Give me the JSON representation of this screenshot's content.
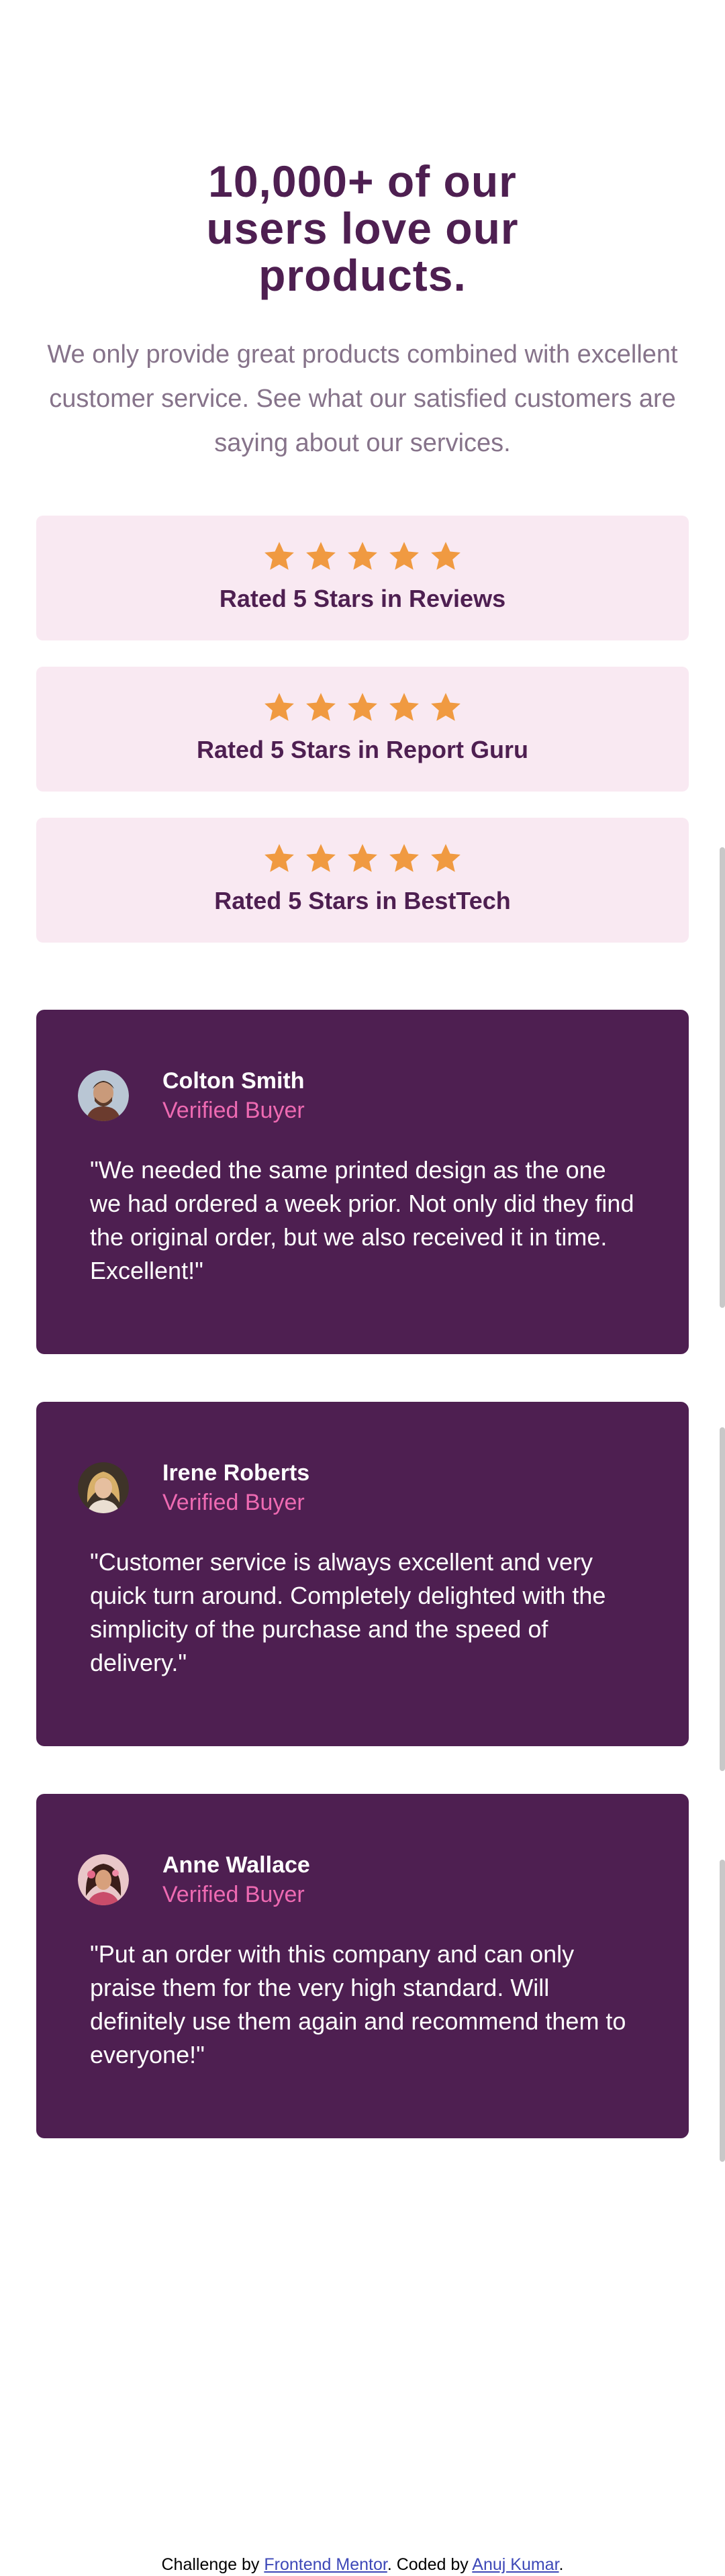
{
  "hero": {
    "title": "10,000+ of our users love our products.",
    "description": "We only provide great products combined with excellent customer service. See what our satisfied customers are saying about our services."
  },
  "ratings": [
    {
      "stars": 5,
      "label": "Rated 5 Stars in Reviews"
    },
    {
      "stars": 5,
      "label": "Rated 5 Stars in Report Guru"
    },
    {
      "stars": 5,
      "label": "Rated 5 Stars in BestTech"
    }
  ],
  "testimonials": [
    {
      "name": "Colton Smith",
      "role": "Verified Buyer",
      "quote": "\"We needed the same printed design as the one we had ordered a week prior. Not only did they find the original order, but we also received it in time. Excellent!\"",
      "avatar_icon": "avatar-colton-smith"
    },
    {
      "name": "Irene Roberts",
      "role": "Verified Buyer",
      "quote": "\"Customer service is always excellent and very quick turn around. Completely delighted with the simplicity of the purchase and the speed of delivery.\"",
      "avatar_icon": "avatar-irene-roberts"
    },
    {
      "name": "Anne Wallace",
      "role": "Verified Buyer",
      "quote": "\"Put an order with this company and can only praise them for the very high standard. Will definitely use them again and recommend them to everyone!\"",
      "avatar_icon": "avatar-anne-wallace"
    }
  ],
  "footer": {
    "prefix": "Challenge by ",
    "link1": "Frontend Mentor",
    "middle": ". Coded by ",
    "link2": "Anuj Kumar",
    "suffix": "."
  },
  "colors": {
    "dark_magenta": "#4e1f51",
    "soft_pink": "#ee6ab2",
    "light_pink": "#f9e9f2",
    "star_orange": "#f09a41",
    "grayish_magenta": "#86738a"
  }
}
